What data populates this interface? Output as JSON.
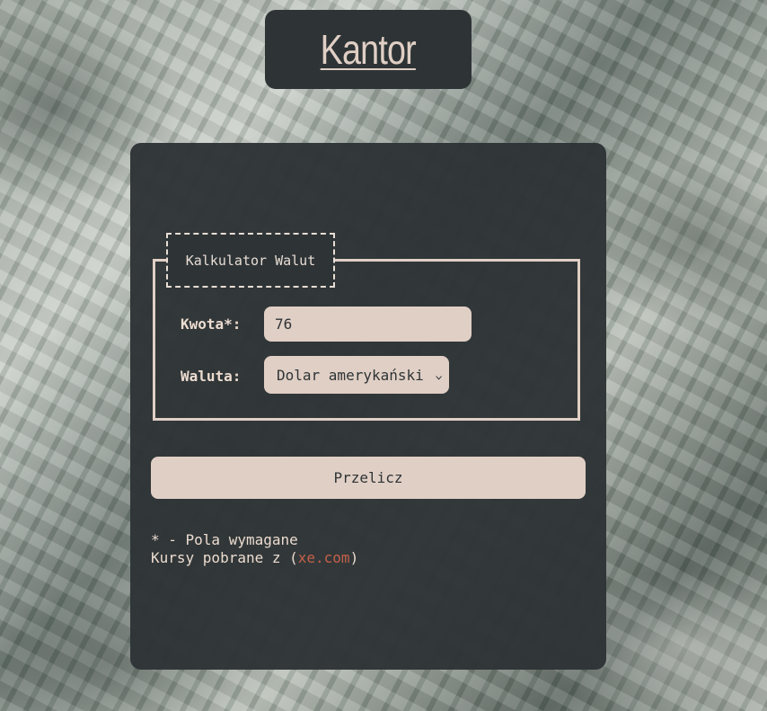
{
  "header": {
    "title": "Kantor"
  },
  "form": {
    "legend": "Kalkulator Walut",
    "amount_label": "Kwota*:",
    "amount_value": "76",
    "currency_label": "Waluta:",
    "currency_selected": "Dolar amerykański",
    "submit_label": "Przelicz"
  },
  "footer": {
    "required_note": "* - Pola wymagane",
    "source_prefix": "Kursy pobrane z (",
    "source_link": "xe.com",
    "source_suffix": ")"
  },
  "colors": {
    "panel": "#2e3436",
    "accent": "#e0cfc5",
    "link": "#c4604a"
  }
}
